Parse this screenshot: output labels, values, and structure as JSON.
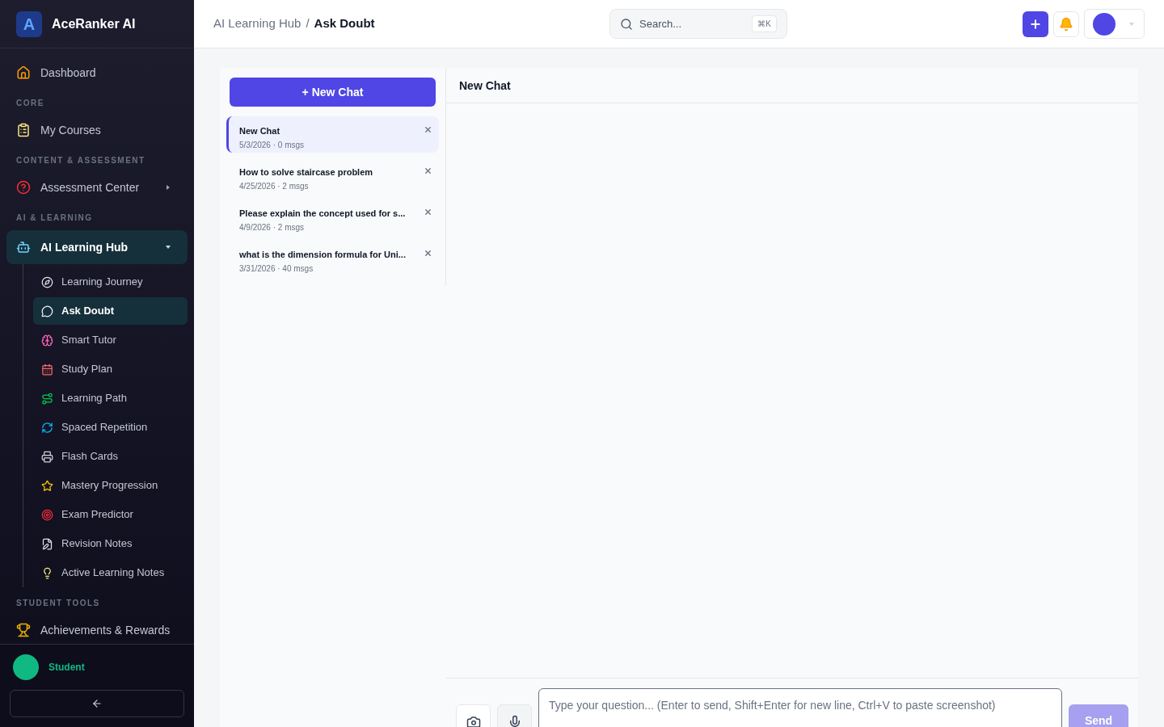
{
  "app": {
    "name": "AceRanker AI",
    "logo_letter": "A"
  },
  "sidebar": {
    "sections": [
      {
        "items": [
          {
            "label": "Dashboard",
            "selected": false
          }
        ]
      },
      {
        "heading": "CORE",
        "items": [
          {
            "label": "My Courses",
            "selected": false
          }
        ]
      },
      {
        "heading": "CONTENT & ASSESSMENT",
        "items": [
          {
            "label": "Assessment Center",
            "selected": false,
            "expanded": false
          }
        ]
      },
      {
        "heading": "AI & LEARNING",
        "items": [
          {
            "label": "AI Learning Hub",
            "selected": true,
            "expanded": true,
            "children": [
              {
                "label": "Learning Journey",
                "selected": false
              },
              {
                "label": "Ask Doubt",
                "selected": true
              },
              {
                "label": "Smart Tutor",
                "selected": false
              },
              {
                "label": "Study Plan",
                "selected": false
              },
              {
                "label": "Learning Path",
                "selected": false
              },
              {
                "label": "Spaced Repetition",
                "selected": false
              },
              {
                "label": "Flash Cards",
                "selected": false
              },
              {
                "label": "Mastery Progression",
                "selected": false
              },
              {
                "label": "Exam Predictor",
                "selected": false
              },
              {
                "label": "Revision Notes",
                "selected": false
              },
              {
                "label": "Active Learning Notes",
                "selected": false
              }
            ]
          }
        ]
      },
      {
        "heading": "STUDENT TOOLS",
        "items": [
          {
            "label": "Achievements & Rewards",
            "selected": false
          }
        ]
      }
    ],
    "user": {
      "role": "Student"
    }
  },
  "topbar": {
    "breadcrumb": [
      "AI Learning Hub",
      "Ask Doubt"
    ],
    "separator": "/",
    "search": {
      "placeholder": "Search...",
      "shortcut": "⌘K"
    }
  },
  "chats": {
    "new_button": "+ New Chat",
    "items": [
      {
        "title": "New Chat",
        "meta": "5/3/2026 · 0 msgs",
        "selected": true
      },
      {
        "title": "How to solve staircase problem",
        "meta": "4/25/2026 · 2 msgs",
        "selected": false
      },
      {
        "title": "Please explain the concept used for s...",
        "meta": "4/9/2026 · 2 msgs",
        "selected": false
      },
      {
        "title": "what is the dimension formula for Uni...",
        "meta": "3/31/2026 · 40 msgs",
        "selected": false
      }
    ]
  },
  "conversation": {
    "title": "New Chat",
    "input": {
      "placeholder": "Type your question... (Enter to send, Shift+Enter for new line, Ctrl+V to paste screenshot)"
    },
    "send": {
      "label": "Send",
      "disabled": true
    }
  }
}
